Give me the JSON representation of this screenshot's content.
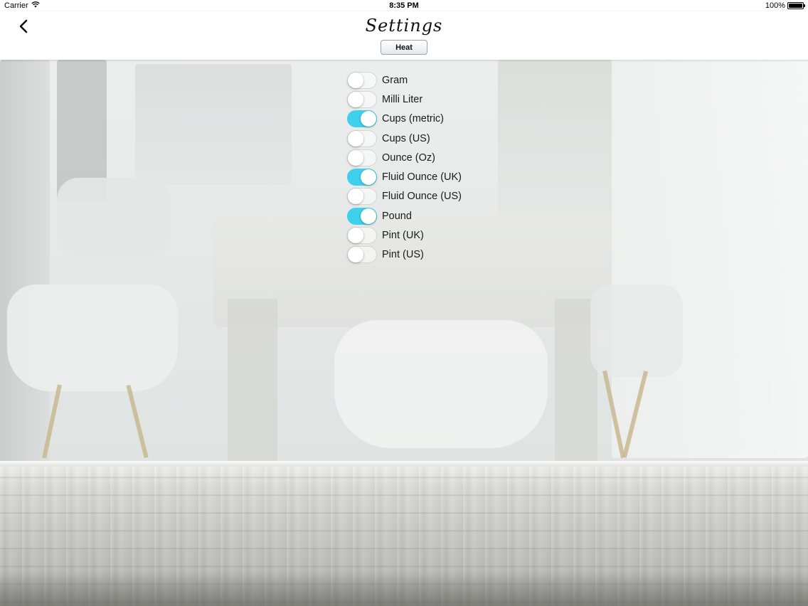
{
  "status_bar": {
    "carrier": "Carrier",
    "time": "8:35 PM",
    "battery": "100%",
    "wifi_icon": "wifi-icon",
    "battery_icon": "battery-icon"
  },
  "nav": {
    "back_icon": "chevron-left-icon",
    "title": "Settings",
    "heat_label": "Heat"
  },
  "units": [
    {
      "label": "Gram",
      "on": false
    },
    {
      "label": "Milli Liter",
      "on": false
    },
    {
      "label": "Cups (metric)",
      "on": true
    },
    {
      "label": "Cups (US)",
      "on": false
    },
    {
      "label": "Ounce (Oz)",
      "on": false
    },
    {
      "label": "Fluid Ounce (UK)",
      "on": true
    },
    {
      "label": "Fluid Ounce (US)",
      "on": false
    },
    {
      "label": "Pound",
      "on": true
    },
    {
      "label": "Pint (UK)",
      "on": false
    },
    {
      "label": "Pint (US)",
      "on": false
    }
  ],
  "colors": {
    "toggle_on": "#3fd0ee",
    "toggle_off": "#ffffff"
  }
}
